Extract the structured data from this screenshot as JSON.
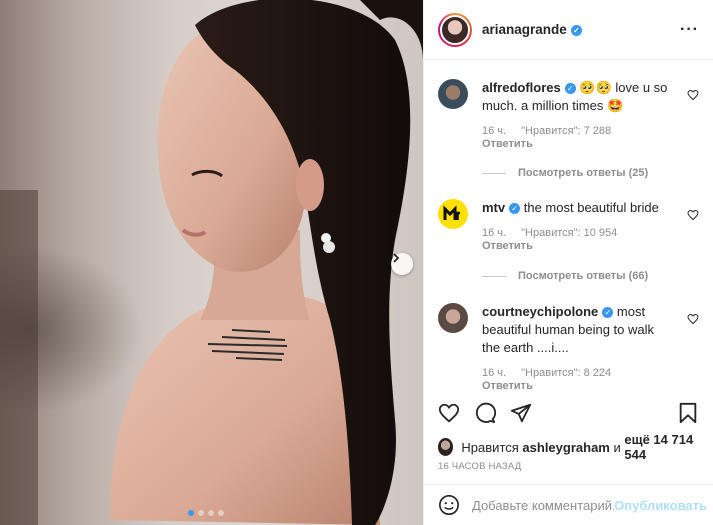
{
  "post": {
    "username": "arianagrande",
    "verified": true,
    "more_icon": "more-horizontal-icon",
    "carousel_total": 4,
    "carousel_active": 1
  },
  "comments": [
    {
      "username": "alfredoflores",
      "text": "🥺🥺 love u so much. a million times 🤩",
      "time": "16 ч.",
      "likes": "\"Нравится\": 7 288",
      "reply": "Ответить",
      "view_replies": "Посмотреть ответы (25)"
    },
    {
      "username": "mtv",
      "text": "the most beautiful bride",
      "time": "16 ч.",
      "likes": "\"Нравится\": 10 954",
      "reply": "Ответить",
      "view_replies": "Посмотреть ответы (66)"
    },
    {
      "username": "courtneychipolone",
      "text": "most beautiful human being to walk the earth ....i....",
      "time": "16 ч.",
      "likes": "\"Нравится\": 8 224",
      "reply": "Ответить"
    }
  ],
  "likes_line": {
    "prefix": "Нравится",
    "user": "ashleygraham",
    "middle": "и",
    "suffix": "ещё 14 714 544"
  },
  "time_ago": "16 ЧАСОВ НАЗАД",
  "add_comment": {
    "placeholder": "Добавьте комментарий...",
    "publish_label": "Опубликовать"
  },
  "colors": {
    "accent": "#3897f0",
    "text": "#262626",
    "muted": "#8e8e8e",
    "publish_disabled": "#b2dffc"
  }
}
